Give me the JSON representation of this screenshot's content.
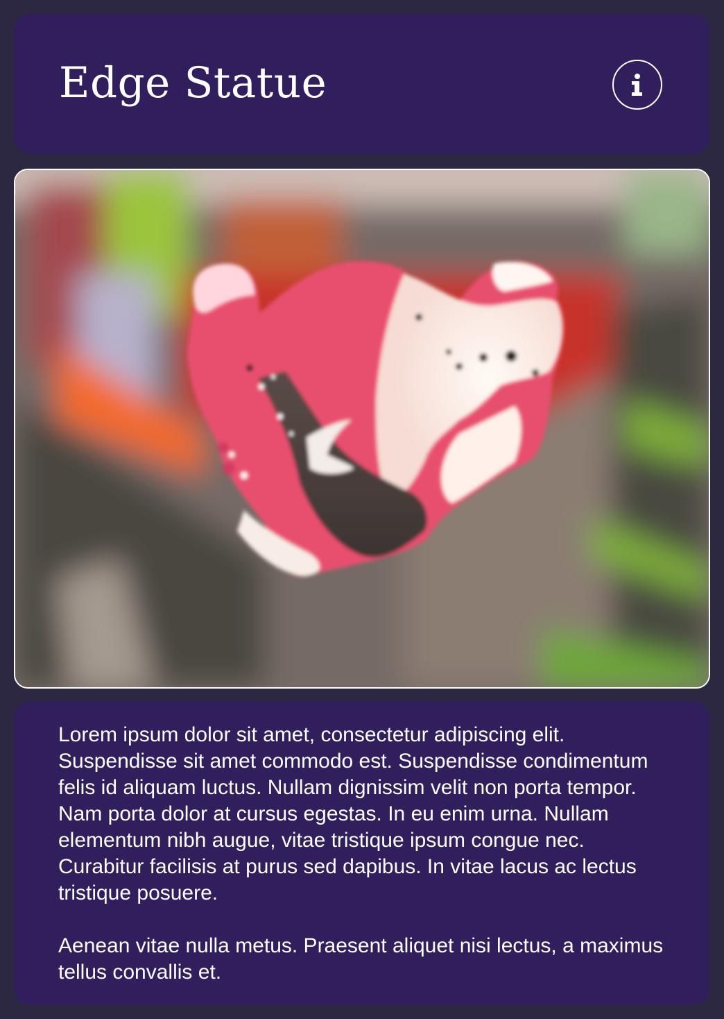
{
  "header": {
    "title": "Edge Statue",
    "info_button_glyph": "i"
  },
  "viewer": {
    "subject_icon": "statue-model",
    "colors": {
      "statue_pink": "#e8506e",
      "statue_white": "#fff4ee",
      "statue_shadow": "#463c38",
      "background_red": "#c8302a",
      "background_green": "#7fae3a"
    }
  },
  "description": {
    "paragraphs": [
      "Lorem ipsum dolor sit amet, consectetur adipiscing elit. Suspendisse sit amet commodo est. Suspendisse condimentum felis id aliquam luctus. Nullam dignissim velit non porta tempor. Nam porta dolor at cursus egestas. In eu enim urna. Nullam elementum nibh augue, vitae tristique ipsum congue nec. Curabitur facilisis at purus sed dapibus. In vitae lacus ac lectus tristique posuere.",
      "Aenean vitae nulla metus. Praesent aliquet nisi lectus, a maximus tellus convallis et."
    ]
  }
}
